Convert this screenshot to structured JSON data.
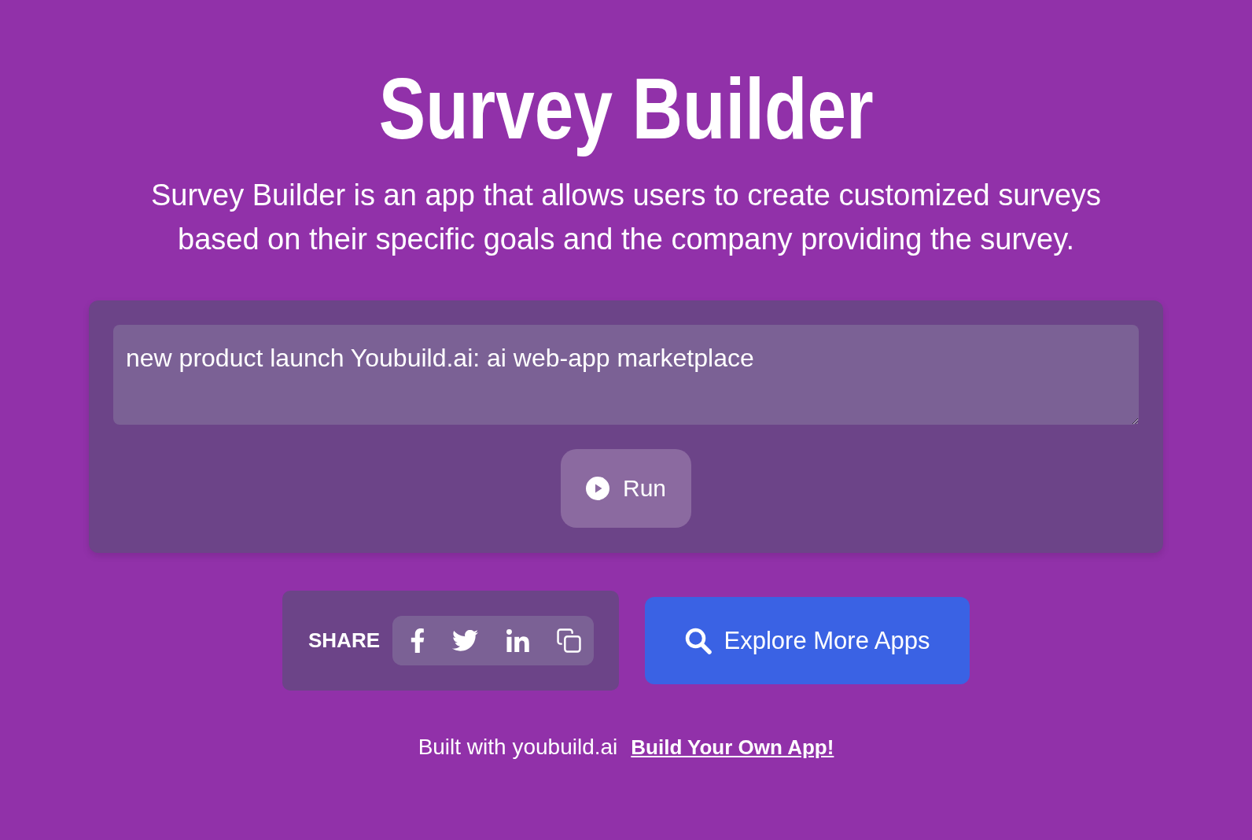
{
  "header": {
    "title": "Survey Builder",
    "description": "Survey Builder is an app that allows users to create customized surveys based on their specific goals and the company providing the survey."
  },
  "form": {
    "input": {
      "value": "new product launch Youbuild.ai: ai web-app marketplace"
    },
    "run_button": {
      "label": "Run"
    }
  },
  "share": {
    "label": "SHARE"
  },
  "explore_button": {
    "label": "Explore More Apps"
  },
  "footer": {
    "text": "Built with youbuild.ai",
    "link": "Build Your Own App!"
  }
}
